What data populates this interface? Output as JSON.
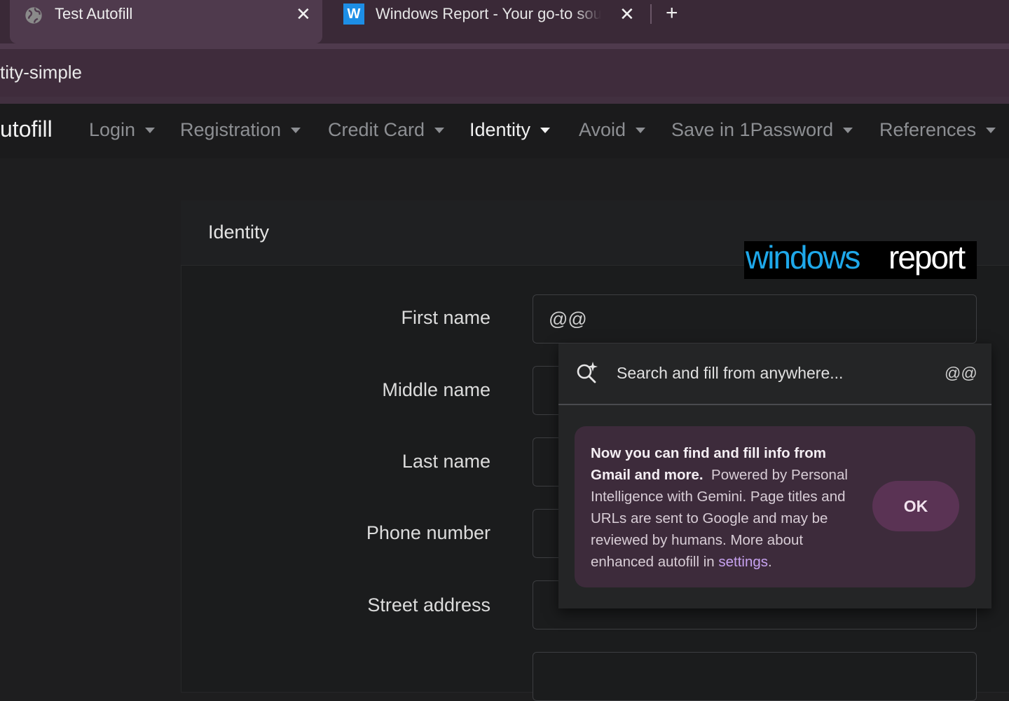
{
  "browser": {
    "tabs": [
      {
        "title": "Test Autofill",
        "icon": "globe-icon",
        "active": true
      },
      {
        "title": "Windows Report - Your go-to source",
        "icon": "windows-report-favicon",
        "favicon_letter": "W",
        "active": false
      }
    ],
    "close_glyph": "✕",
    "new_tab_glyph": "+",
    "address_text": "tity-simple"
  },
  "site": {
    "brand": "utofill",
    "nav": [
      {
        "label": "Login"
      },
      {
        "label": "Registration"
      },
      {
        "label": "Credit Card"
      },
      {
        "label": "Identity",
        "active": true
      },
      {
        "label": "Avoid"
      },
      {
        "label": "Save in 1Password"
      },
      {
        "label": "References"
      }
    ]
  },
  "card": {
    "title": "Identity",
    "logo": {
      "part1": "windows",
      "part2": "report"
    },
    "fields": [
      {
        "label": "First name",
        "value": "@@"
      },
      {
        "label": "Middle name",
        "value": ""
      },
      {
        "label": "Last name",
        "value": ""
      },
      {
        "label": "Phone number",
        "value": ""
      },
      {
        "label": "Street address",
        "value": ""
      }
    ]
  },
  "autofill_popup": {
    "search_text": "Search and fill from anywhere...",
    "search_shortcut": "@@",
    "promo": {
      "bold": "Now you can find and fill info from Gmail and more.",
      "body": "Powered by Personal Intelligence with Gemini. Page titles and URLs are sent to Google and may be reviewed by humans. More about enhanced autofill in",
      "link": "settings",
      "end": "."
    },
    "ok_label": "OK"
  },
  "colors": {
    "tabstrip": "#3a2937",
    "active_tab": "#4f3a4d",
    "promo_bg": "#3d2b3b",
    "ok_bg": "#5a3354",
    "link": "#c7a2f0",
    "logo_blue": "#1ea8ea"
  }
}
